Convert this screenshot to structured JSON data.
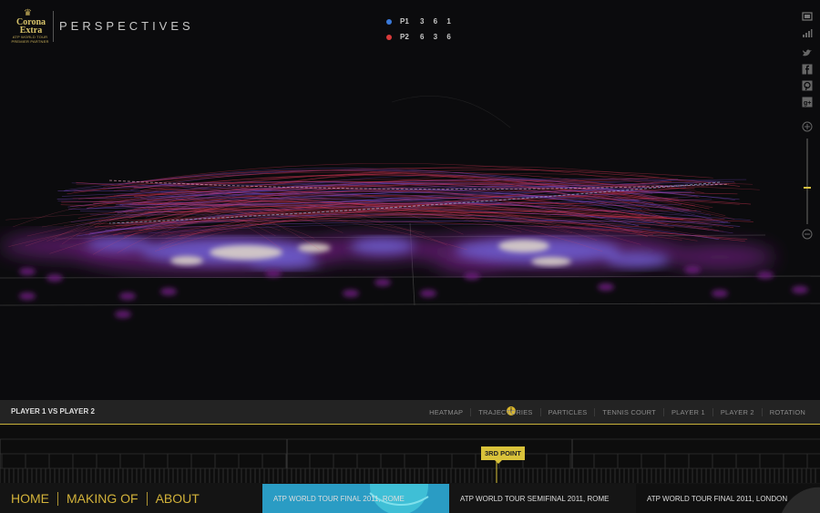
{
  "header": {
    "logo_crown": "♛",
    "logo_brand": "Corona Extra",
    "logo_sub": "ATP WORLD TOUR PREMIER PARTNER",
    "title": "PERSPECTIVES"
  },
  "score": {
    "players": [
      {
        "name": "P1",
        "sets": "3 6 1",
        "color": "#3a79d9"
      },
      {
        "name": "P2",
        "sets": "6 3 6",
        "color": "#d93a3a"
      }
    ]
  },
  "toolbar": {
    "icons": [
      "fullscreen-icon",
      "stats-icon",
      "twitter-icon",
      "facebook-icon",
      "pinterest-icon",
      "google-plus-icon",
      "zoom-in-icon",
      "zoom-out-icon"
    ],
    "zoom_level": 0.43
  },
  "control_bar": {
    "match_title": "PLAYER 1 VS PLAYER 2",
    "info_glyph": "i",
    "toggles": [
      "HEATMAP",
      "TRAJECTORIES",
      "PARTICLES",
      "TENNIS COURT",
      "PLAYER 1",
      "PLAYER 2",
      "ROTATION"
    ]
  },
  "timeline": {
    "current_point_label": "3RD POINT"
  },
  "bottom_nav": {
    "links": [
      "HOME",
      "MAKING OF",
      "ABOUT"
    ],
    "matches": [
      {
        "title": "ATP WORLD TOUR FINAL 2011, ROME"
      },
      {
        "title": "ATP WORLD TOUR SEMIFINAL 2011, ROME"
      },
      {
        "title": "ATP WORLD TOUR FINAL 2011, LONDON"
      }
    ]
  },
  "colors": {
    "accent": "#d2b23a",
    "p1": "#3a79d9",
    "p2": "#d93a3a",
    "heat_core": "#e0d7c8",
    "heat_mid": "#6b5ac9",
    "heat_edge": "#6a1f7a"
  }
}
